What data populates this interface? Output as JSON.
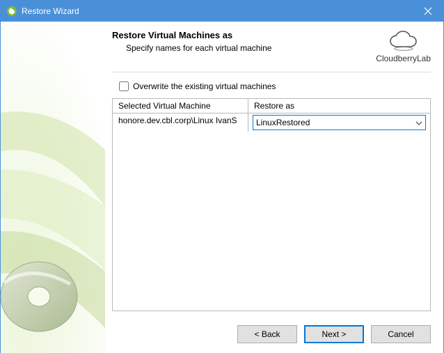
{
  "window": {
    "title": "Restore Wizard"
  },
  "header": {
    "heading": "Restore Virtual Machines as",
    "sub": "Specify names for each virtual machine"
  },
  "brand": {
    "name": "CloudberryLab"
  },
  "overwrite": {
    "label": "Overwrite the existing virtual machines",
    "checked": false
  },
  "grid": {
    "columns": {
      "a": "Selected Virtual Machine",
      "b": "Restore as"
    },
    "rows": [
      {
        "selected": "honore.dev.cbl.corp\\Linux IvanS",
        "restore_as": "LinuxRestored"
      }
    ]
  },
  "buttons": {
    "back": "< Back",
    "next": "Next >",
    "cancel": "Cancel"
  }
}
